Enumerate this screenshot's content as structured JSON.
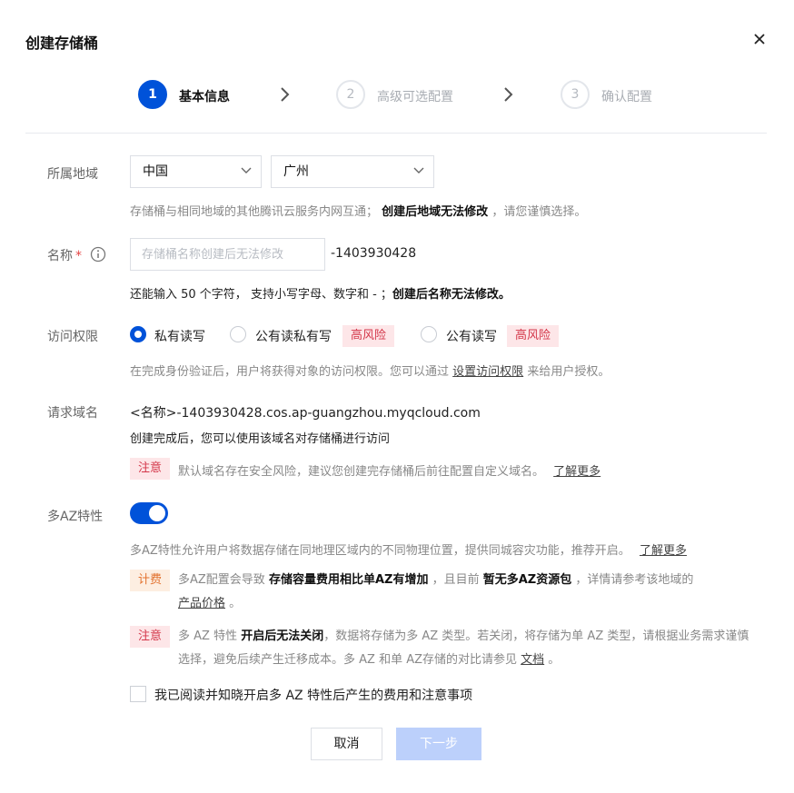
{
  "dialog": {
    "title": "创建存储桶"
  },
  "steps": [
    {
      "num": "1",
      "label": "基本信息"
    },
    {
      "num": "2",
      "label": "高级可选配置"
    },
    {
      "num": "3",
      "label": "确认配置"
    }
  ],
  "region": {
    "label": "所属地域",
    "country": "中国",
    "city": "广州",
    "help_pre": "存储桶与相同地域的其他腾讯云服务内网互通；",
    "help_bold": "创建后地域无法修改",
    "help_post": "，请您谨慎选择。"
  },
  "name": {
    "label": "名称",
    "required_mark": "*",
    "placeholder": "存储桶名称创建后无法修改",
    "value": "",
    "suffix": "-1403930428",
    "help_pre": "还能输入 50 个字符， 支持小写字母、数字和 - ；",
    "help_bold": "创建后名称无法修改。"
  },
  "access": {
    "label": "访问权限",
    "options": [
      {
        "label": "私有读写",
        "selected": true,
        "risk": ""
      },
      {
        "label": "公有读私有写",
        "selected": false,
        "risk": "高风险"
      },
      {
        "label": "公有读写",
        "selected": false,
        "risk": "高风险"
      }
    ],
    "help_pre": "在完成身份验证后，用户将获得对象的访问权限。您可以通过",
    "help_link": "设置访问权限",
    "help_post": "来给用户授权。"
  },
  "domain": {
    "label": "请求域名",
    "value": "<名称>-1403930428.cos.ap-guangzhou.myqcloud.com",
    "desc": "创建完成后，您可以使用该域名对存储桶进行访问",
    "note_tag": "注意",
    "note_text": "默认域名存在安全风险，建议您创建完存储桶后前往配置自定义域名。",
    "note_link": "了解更多"
  },
  "multi_az": {
    "label": "多AZ特性",
    "enabled": true,
    "desc": "多AZ特性允许用户将数据存储在同地理区域内的不同物理位置，提供同城容灾功能，推荐开启。",
    "desc_link": "了解更多",
    "fee_tag": "计费",
    "fee_1": "多AZ配置会导致",
    "fee_bold_1": "存储容量费用相比单AZ有增加",
    "fee_2": "，且目前",
    "fee_bold_2": "暂无多AZ资源包",
    "fee_3": "，详情请参考该地域的",
    "fee_link": "产品价格",
    "fee_4": "。",
    "note_tag": "注意",
    "note_1": "多 AZ 特性",
    "note_bold": "开启后无法关闭",
    "note_2": "，数据将存储为多 AZ 类型。若关闭，将存储为单 AZ 类型，请根据业务需求谨慎选择，避免后续产生迁移成本。多 AZ 和单 AZ存储的对比请参见",
    "note_link": "文档",
    "note_3": "。",
    "confirm_label": "我已阅读并知晓开启多 AZ 特性后产生的费用和注意事项",
    "confirm_checked": false
  },
  "buttons": {
    "cancel": "取消",
    "next": "下一步"
  },
  "colors": {
    "primary": "#0052d9",
    "danger": "#d4374a",
    "warning": "#e2722f",
    "disabled": "#bcd0fb"
  },
  "icons": [
    "close-icon",
    "chevron-right-icon",
    "chevron-down-icon",
    "info-icon"
  ]
}
